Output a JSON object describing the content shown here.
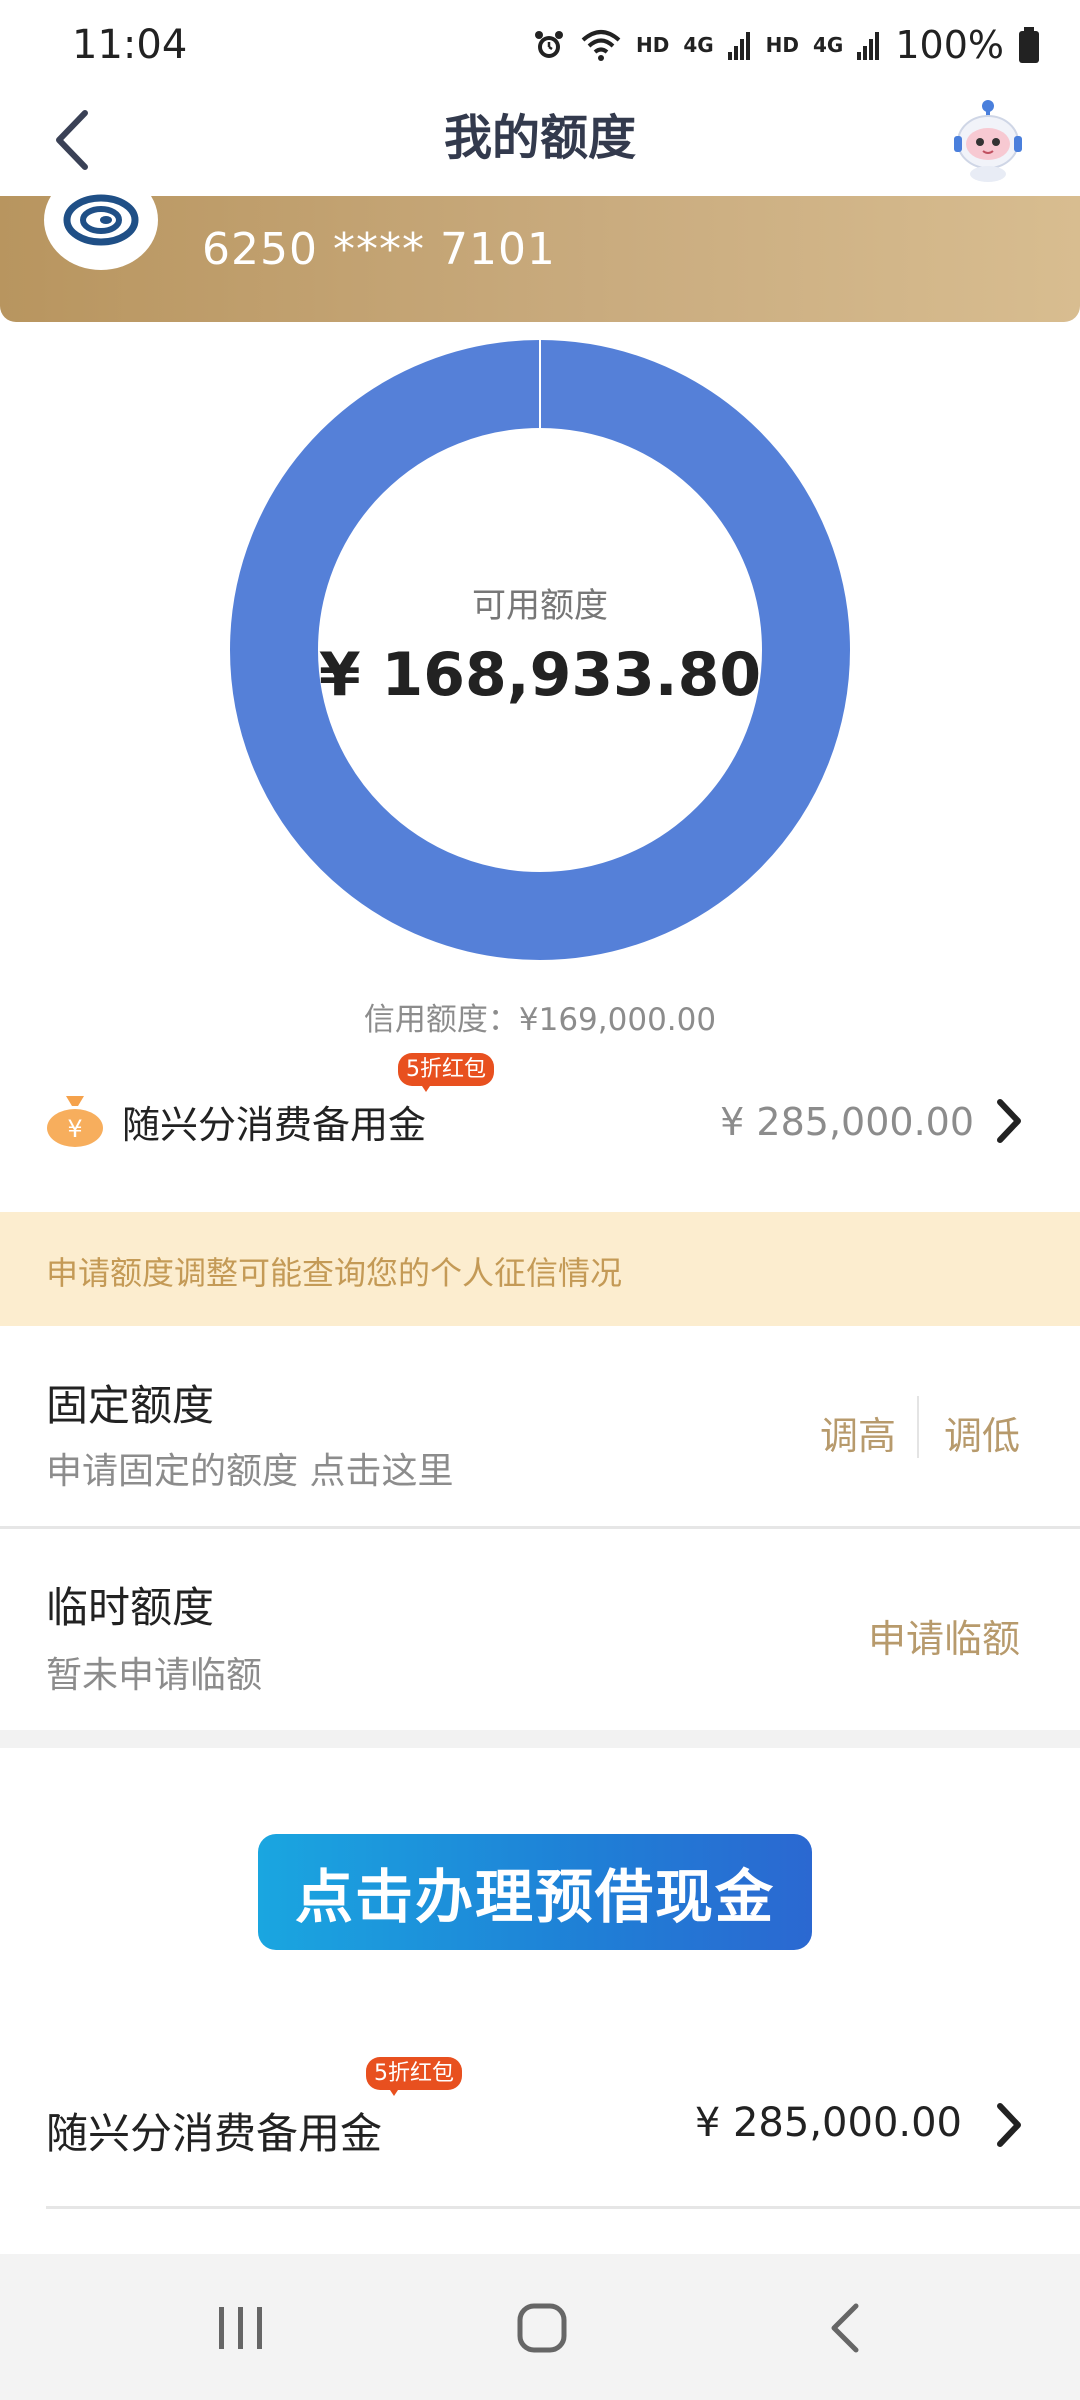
{
  "status_bar": {
    "time": "11:04",
    "net1": "HD",
    "net1_gen": "4G",
    "net2": "HD",
    "net2_gen": "4G",
    "battery": "100%"
  },
  "nav": {
    "title": "我的额度",
    "back_icon": "chevron-left-icon",
    "assistant_icon": "robot-assistant-icon"
  },
  "card": {
    "number": "6250 **** 7101",
    "logo_icon": "bank-logo-icon"
  },
  "limit_chart": {
    "available_label": "可用额度",
    "available_amount": "¥ 168,933.80",
    "credit_line": "信用额度：¥169,000.00",
    "used_fraction": 0.0004,
    "ring_color": "#5580d8"
  },
  "reserve_row": {
    "icon": "money-bag-icon",
    "label": "随兴分消费备用金",
    "badge": "5折红包",
    "amount": "¥ 285,000.00"
  },
  "notice": {
    "text": "申请额度调整可能查询您的个人征信情况"
  },
  "fixed_limit": {
    "title": "固定额度",
    "subtitle": "申请固定的额度 点击这里",
    "raise": "调高",
    "lower": "调低"
  },
  "temp_limit": {
    "title": "临时额度",
    "subtitle": "暂未申请临额",
    "apply": "申请临额"
  },
  "banner": {
    "text": "点击办理预借现金"
  },
  "reserve_row2": {
    "label": "随兴分消费备用金",
    "badge": "5折红包",
    "amount": "¥ 285,000.00"
  },
  "system_nav": {
    "recents_icon": "recents-icon",
    "home_icon": "home-icon",
    "back_icon": "back-icon"
  }
}
